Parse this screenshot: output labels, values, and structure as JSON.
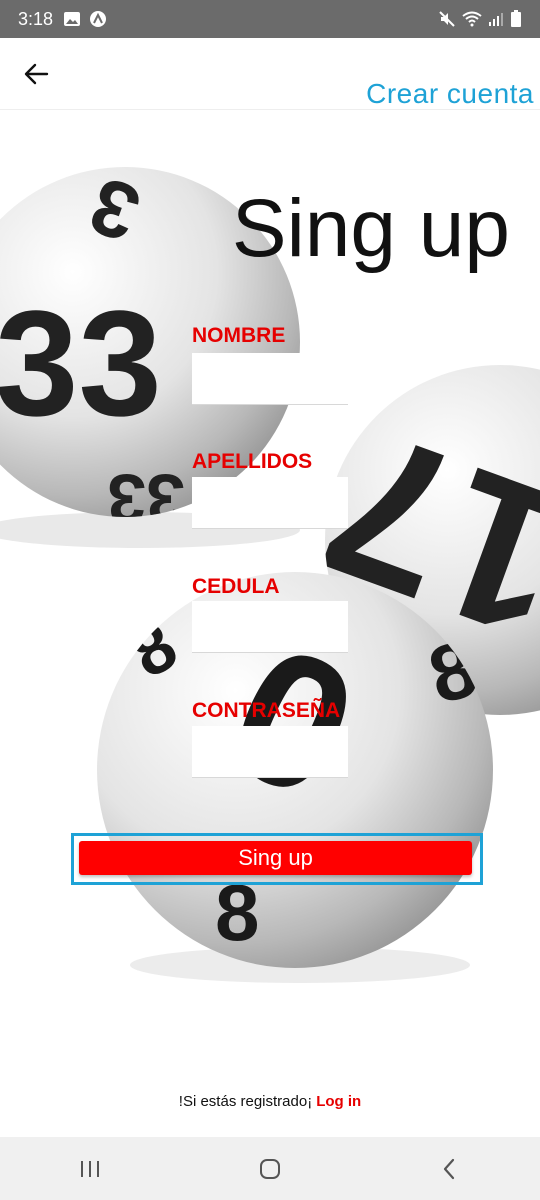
{
  "status_bar": {
    "time": "3:18",
    "icons_left": [
      "gallery-icon",
      "app-notification-icon"
    ],
    "icons_right": [
      "mute-icon",
      "wifi-icon",
      "signal-icon",
      "battery-icon"
    ]
  },
  "app_bar": {
    "title": "Crear cuenta",
    "back_icon": "arrow-left-icon"
  },
  "form": {
    "heading": "Sing up",
    "fields": [
      {
        "label": "NOMBRE",
        "value": ""
      },
      {
        "label": "APELLIDOS",
        "value": ""
      },
      {
        "label": "CEDULA",
        "value": ""
      },
      {
        "label": "CONTRASEÑA",
        "value": ""
      }
    ],
    "submit_label": "Sing up"
  },
  "footer": {
    "prompt": "!Si estás registrado¡",
    "login_link": "Log in"
  },
  "background_ball_numbers": [
    "33",
    "3",
    "33",
    "17",
    "8",
    "0",
    "8",
    "8"
  ],
  "colors": {
    "accent": "#1ea2d6",
    "label_red": "#e60000",
    "button_red": "#ff0000",
    "status_bar": "#6b6b6b"
  }
}
